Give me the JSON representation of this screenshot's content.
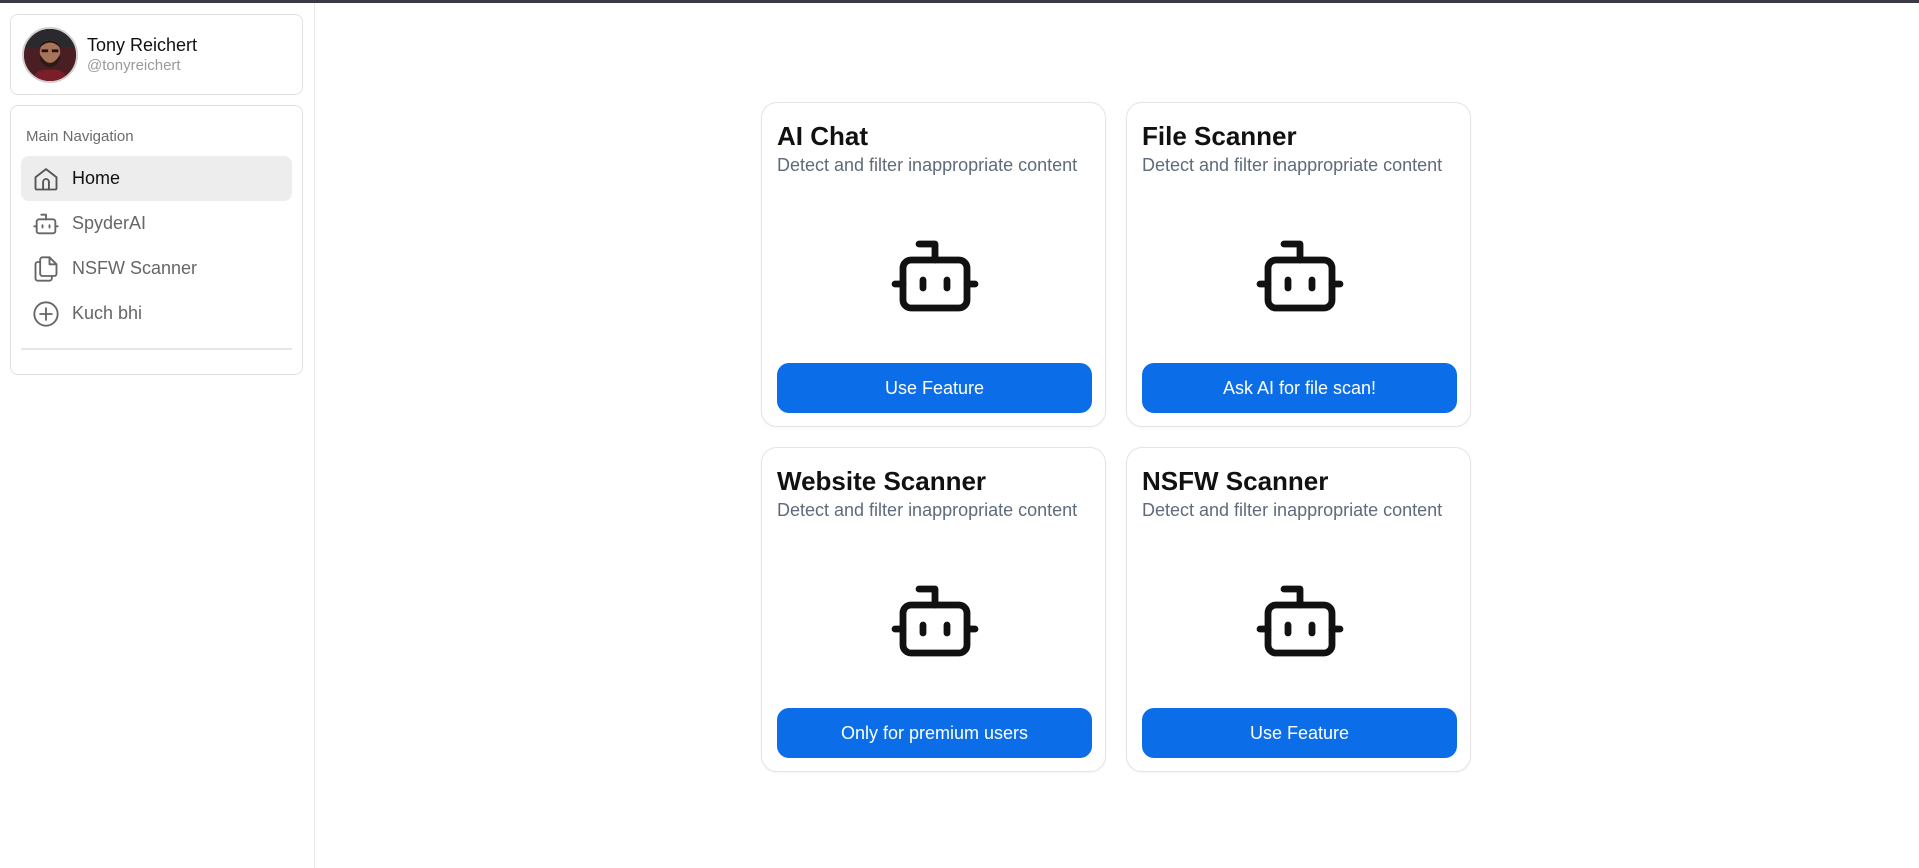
{
  "profile": {
    "name": "Tony Reichert",
    "handle": "@tonyreichert"
  },
  "sidebar": {
    "section_title": "Main Navigation",
    "items": [
      {
        "label": "Home",
        "icon": "home-icon",
        "active": true
      },
      {
        "label": "SpyderAI",
        "icon": "robot-icon",
        "active": false
      },
      {
        "label": "NSFW Scanner",
        "icon": "files-icon",
        "active": false
      },
      {
        "label": "Kuch bhi",
        "icon": "plus-circle-icon",
        "active": false
      }
    ]
  },
  "cards": [
    {
      "title": "AI Chat",
      "description": "Detect and filter inappropriate content",
      "icon": "robot-icon",
      "button": "Use Feature"
    },
    {
      "title": "File Scanner",
      "description": "Detect and filter inappropriate content",
      "icon": "robot-icon",
      "button": "Ask AI for file scan!"
    },
    {
      "title": "Website Scanner",
      "description": "Detect and filter inappropriate content",
      "icon": "robot-icon",
      "button": "Only for premium users"
    },
    {
      "title": "NSFW Scanner",
      "description": "Detect and filter inappropriate content",
      "icon": "robot-icon",
      "button": "Use Feature"
    }
  ],
  "colors": {
    "primary_button": "#0b6ee8",
    "active_nav_bg": "#ededed",
    "muted_text": "#5f6b7a"
  }
}
